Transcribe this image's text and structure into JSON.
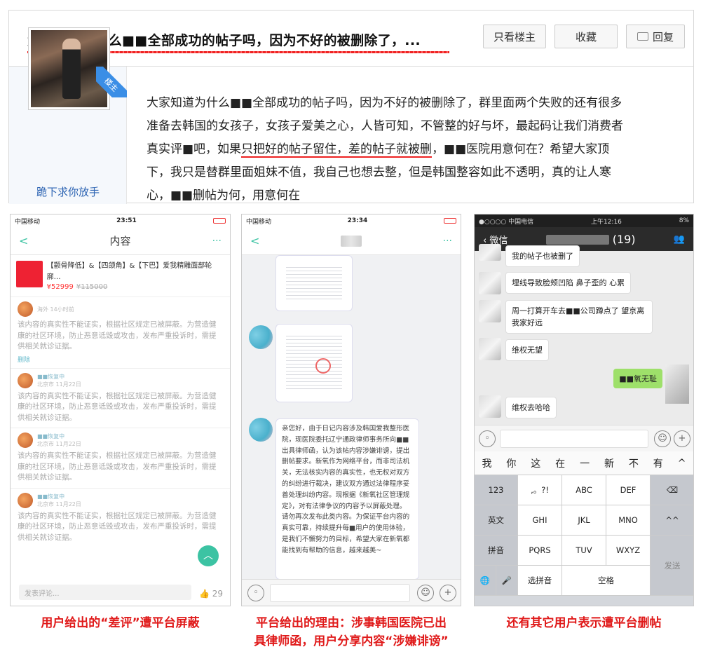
{
  "post": {
    "title": "大家知道为什么■■全部成功的帖子吗，因为不好的被删除了，...",
    "buttons": {
      "only_op": "只看楼主",
      "favorite": "收藏",
      "reply": "回复"
    },
    "op_badge": "楼主",
    "username": "跪下求你放手",
    "body_lines": [
      "大家知道为什么■■全部成功的帖子吗，因为不好的被删除了，群里面两个失败的还有很多",
      "准备去韩国的女孩子，女孩子爱美之心，人皆可知，不管整的好与坏，最起码让我们消费者",
      "真实评■吧，如果只把好的帖子留住，差的帖子就被删，■■医院用意何在？希望大家顶",
      "下，我只是替群里面姐妹不值，我自己也想去整，但是韩国整容如此不透明，真的让人寒",
      "心，■■删帖为何，用意何在"
    ],
    "body_underlined": "只把好的帖子留住，差的帖子就被删"
  },
  "panel1": {
    "carrier": "中国移动",
    "time": "23:51",
    "nav_title": "内容",
    "back": "<",
    "more": "···",
    "product": {
      "text": "【颧骨降低】&【四颌角】&【下巴】爱我精雕面部轮廓…",
      "price": "¥52999",
      "orig_price": "¥115000"
    },
    "comments": [
      {
        "user": "",
        "meta": "海外 14小时前",
        "text": "该内容的真实性不能证实，根据社区规定已被屏蔽。为营造健康的社区环境，防止恶意诋毁或攻击，发布严重投诉时，需提供相关就诊证据。",
        "delete": "删除"
      },
      {
        "user": "■■恢复中",
        "meta": "北京市 11月22日",
        "text": "该内容的真实性不能证实，根据社区规定已被屏蔽。为营造健康的社区环境，防止恶意诋毁或攻击，发布严重投诉时，需提供相关就诊证据。"
      },
      {
        "user": "■■恢复中",
        "meta": "北京市 11月22日",
        "text": "该内容的真实性不能证实，根据社区规定已被屏蔽。为营造健康的社区环境，防止恶意诋毁或攻击，发布严重投诉时，需提供相关就诊证据。"
      },
      {
        "user": "■■恢复中",
        "meta": "北京市 11月22日",
        "text": "该内容的真实性不能证实，根据社区规定已被屏蔽。为营造健康的社区环境，防止恶意诋毁或攻击，发布严重投诉时，需提供相关就诊证据。"
      }
    ],
    "input_placeholder": "发表评论...",
    "like_count": "29"
  },
  "panel2": {
    "carrier": "中国移动",
    "time": "23:34",
    "back": "<",
    "more": "···",
    "message": "亲您好，由于日记内容涉及韩国爱我整形医院，现医院委托辽宁通政律师事务所向■■出具律师函，认为该帖内容涉嫌诽谤，提出删帖要求。新氧作为网络平台，而非司法机关，无法核实内容的真实性，也无权对双方的纠纷进行裁决，建议双方通过法律程序妥善处理纠纷内容。现根据《新氧社区管理规定》，对有法律争议的内容予以屏蔽处理。请勿再次发布此类内容。为保证平台内容的真实可靠，持续提升每■用户的使用体验，是我们不懈努力的目标，希望大家在新氧都能找到有帮助的信息，越来越美~"
  },
  "panel3": {
    "carrier": "●○○○○ 中国电信",
    "time": "上午12:16",
    "battery": "8%",
    "back": "微信",
    "chat_count": "(19)",
    "messages": [
      "我的帖子也被删了",
      "埋线导致脸颊凹陷 鼻子歪的 心累",
      "周一打算开车去■■公司蹲点了 望京离我家好远",
      "维权无望",
      "维权去哈哈"
    ],
    "my_message": "■■氧无耻",
    "candidates": [
      "我",
      "你",
      "这",
      "在",
      "一",
      "新",
      "不",
      "有",
      "^"
    ],
    "keys": {
      "row1": [
        "123",
        ",。?!",
        "ABC",
        "DEF",
        "⌫"
      ],
      "row2": [
        "英文",
        "GHI",
        "JKL",
        "MNO",
        "^^"
      ],
      "row3": [
        "拼音",
        "PQRS",
        "TUV",
        "WXYZ",
        "发送"
      ],
      "row4": [
        "🌐",
        "🎤",
        "选拼音",
        "空格"
      ]
    }
  },
  "captions": {
    "c1": "用户给出的“差评”遭平台屏蔽",
    "c2": "平台给出的理由：涉事韩国医院已出具律师函，用户分享内容“涉嫌诽谤”",
    "c2_line1": "平台给出的理由：涉事韩国医院已出",
    "c2_line2": "具律师函，用户分享内容“涉嫌诽谤”",
    "c3": "还有其它用户表示遭平台删帖"
  }
}
